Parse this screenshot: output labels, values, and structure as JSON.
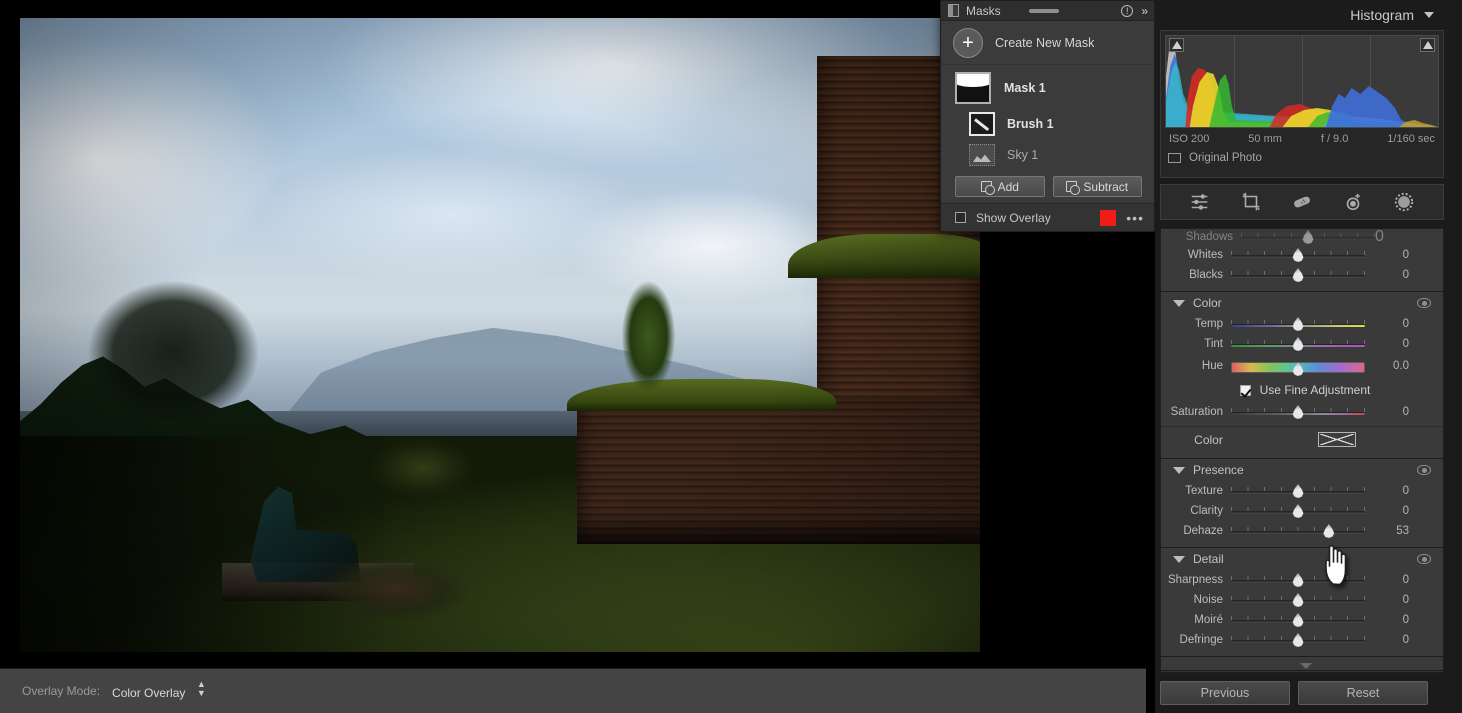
{
  "app": {
    "bottom_bar": {
      "overlay_mode_label": "Overlay Mode:",
      "overlay_mode_value": "Color Overlay",
      "stepper_icon": "up-down-arrows-icon"
    }
  },
  "masks_panel": {
    "title": "Masks",
    "header_icons": {
      "panel": "panel-icon",
      "grip": "drag-grip",
      "info": "info-icon",
      "expand": "double-chevron-right-icon"
    },
    "create_new_mask": {
      "label": "Create New Mask",
      "icon": "plus-circle-icon"
    },
    "items": [
      {
        "name": "Mask 1",
        "icon": "mask-thumbnail",
        "selected": true
      },
      {
        "name": "Brush 1",
        "icon": "brush-icon",
        "selected": true
      },
      {
        "name": "Sky 1",
        "icon": "sky-select-icon",
        "selected": false
      }
    ],
    "add_button": {
      "label": "Add",
      "icon": "add-mask-icon"
    },
    "subtract_button": {
      "label": "Subtract",
      "icon": "subtract-mask-icon"
    },
    "show_overlay": {
      "label": "Show Overlay",
      "checked": false,
      "color": "#ee1b16",
      "more_icon": "ellipsis-icon"
    }
  },
  "right_panel": {
    "histogram": {
      "title": "Histogram",
      "collapse_icon": "triangle-down-icon",
      "shadow_clip_icon": "triangle-up-icon",
      "highlight_clip_icon": "triangle-up-icon",
      "meta": {
        "iso": "ISO 200",
        "focal": "50 mm",
        "aperture": "f / 9.0",
        "shutter": "1/160 sec"
      },
      "original_photo": {
        "label": "Original Photo",
        "checked": false
      }
    },
    "tool_strip": [
      {
        "name": "edit-sliders-icon"
      },
      {
        "name": "crop-icon"
      },
      {
        "name": "healing-brush-icon"
      },
      {
        "name": "red-eye-icon"
      },
      {
        "name": "masking-icon"
      }
    ],
    "sections": [
      {
        "id": "light-cut",
        "rows": [
          {
            "label": "Shadows",
            "value": "0",
            "pos": 50,
            "cut": true
          },
          {
            "label": "Whites",
            "value": "0",
            "pos": 50
          },
          {
            "label": "Blacks",
            "value": "0",
            "pos": 50
          }
        ]
      },
      {
        "id": "color",
        "title": "Color",
        "eye_icon": "visibility-eye-icon",
        "rows": [
          {
            "label": "Temp",
            "value": "0",
            "pos": 50,
            "grad": "temp"
          },
          {
            "label": "Tint",
            "value": "0",
            "pos": 50,
            "grad": "tint"
          },
          {
            "label": "Hue",
            "value": "0.0",
            "pos": 50,
            "grad": "hue",
            "fat": true
          },
          {
            "label": "Saturation",
            "value": "0",
            "pos": 50,
            "grad": "sat"
          }
        ],
        "fine_adjustment": {
          "label": "Use Fine Adjustment",
          "checked": true
        },
        "color_picker": {
          "label": "Color",
          "icon": "color-swatch-none-icon"
        }
      },
      {
        "id": "presence",
        "title": "Presence",
        "eye_icon": "visibility-eye-icon",
        "rows": [
          {
            "label": "Texture",
            "value": "0",
            "pos": 50
          },
          {
            "label": "Clarity",
            "value": "0",
            "pos": 50
          },
          {
            "label": "Dehaze",
            "value": "53",
            "pos": 73
          }
        ]
      },
      {
        "id": "detail",
        "title": "Detail",
        "eye_icon": "visibility-eye-icon",
        "rows": [
          {
            "label": "Sharpness",
            "value": "0",
            "pos": 50
          },
          {
            "label": "Noise",
            "value": "0",
            "pos": 50
          },
          {
            "label": "Moiré",
            "value": "0",
            "pos": 50
          },
          {
            "label": "Defringe",
            "value": "0",
            "pos": 50
          }
        ]
      }
    ],
    "previous_button": "Previous",
    "reset_button": "Reset"
  }
}
